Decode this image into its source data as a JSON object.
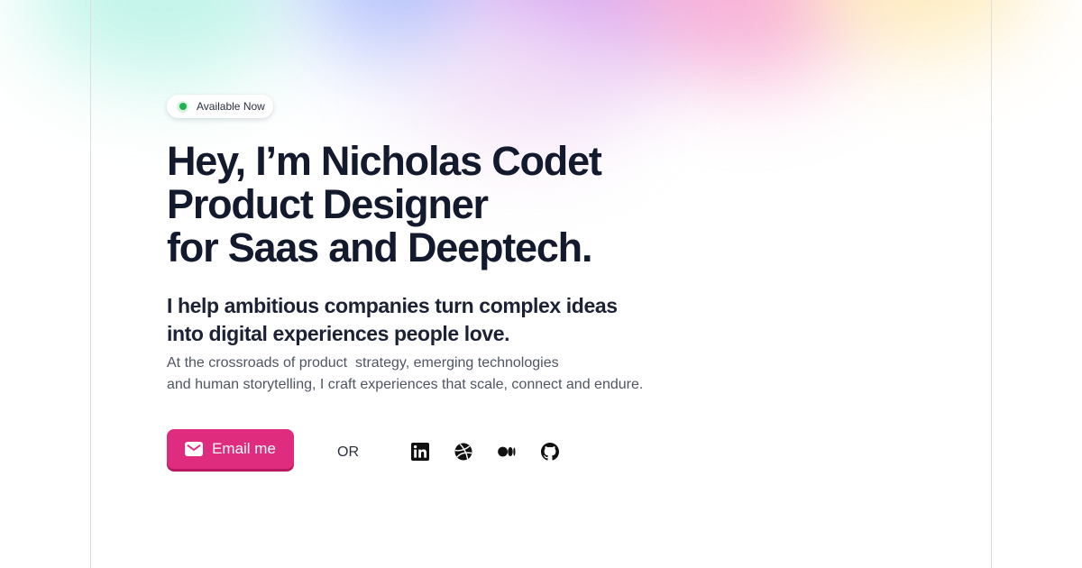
{
  "status_badge": {
    "label": "Available Now",
    "color": "#1fb350"
  },
  "hero": {
    "headline": [
      "Hey, I’m Nicholas Codet",
      "Product Designer",
      "for Saas and Deeptech."
    ],
    "subheadline": [
      "I help ambitious companies turn complex ideas",
      "into digital experiences people love."
    ],
    "body": [
      "At the crossroads of product  strategy, emerging technologies",
      "and human storytelling, I craft experiences that scale, connect and endure."
    ]
  },
  "cta": {
    "email_label": "Email me",
    "email_icon": "mail-icon",
    "accent_color": "#df2c7e",
    "or_label": "OR"
  },
  "socials": [
    {
      "icon": "linkedin-icon"
    },
    {
      "icon": "dribbble-icon"
    },
    {
      "icon": "medium-icon"
    },
    {
      "icon": "github-icon"
    }
  ]
}
